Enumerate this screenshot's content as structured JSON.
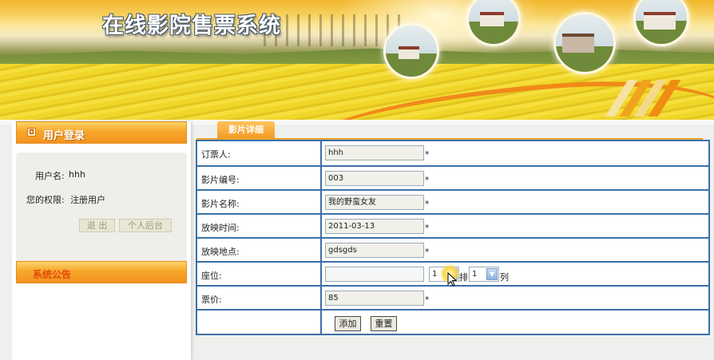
{
  "header": {
    "title": "在线影院售票系统"
  },
  "sidebar": {
    "login_panel": {
      "title": "用户登录",
      "username_label": "用户名:",
      "username_value": "hhh",
      "role_label": "您的权限:",
      "role_value": "注册用户",
      "logout_button": "退 出",
      "backend_button": "个人后台"
    },
    "notice_panel": {
      "title": "系统公告"
    }
  },
  "main": {
    "tab_label": "影片详细",
    "form": {
      "rows": [
        {
          "label": "订票人:",
          "value": "hhh",
          "required": "*"
        },
        {
          "label": "影片编号:",
          "value": "003",
          "required": "*"
        },
        {
          "label": "影片名称:",
          "value": "我的野蛮女友",
          "required": "*"
        },
        {
          "label": "放映时间:",
          "value": "2011-03-13",
          "required": "*"
        },
        {
          "label": "放映地点:",
          "value": "gdsgds",
          "required": "*"
        },
        {
          "label": "座位:",
          "value": ""
        },
        {
          "label": "票价:",
          "value": "85",
          "required": "*"
        }
      ],
      "seat": {
        "row_value": "1",
        "row_unit": "排",
        "col_value": "1",
        "col_unit": "列"
      },
      "add_button": "添加",
      "reset_button": "重置"
    }
  },
  "colors": {
    "accent_orange": "#f39321",
    "table_border": "#3d6fa8",
    "notice_title": "#e24a0a"
  }
}
